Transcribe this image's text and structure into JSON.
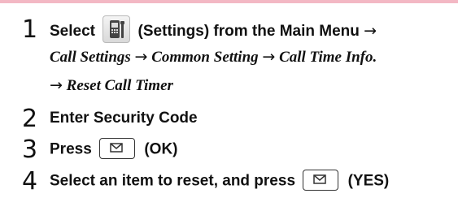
{
  "steps": [
    {
      "number": "1",
      "text_before": "Select",
      "text_after": "(Settings) from the Main Menu",
      "arrow1": "→",
      "path": [
        "Call Settings",
        "Common Setting",
        "Call Time Info.",
        "Reset Call Timer"
      ],
      "arrow": "→"
    },
    {
      "number": "2",
      "text": "Enter Security Code"
    },
    {
      "number": "3",
      "text_before": "Press",
      "text_after": "(OK)"
    },
    {
      "number": "4",
      "text_before": "Select an item to reset, and press",
      "text_after": "(YES)"
    }
  ],
  "icons": {
    "settings": "settings-phone-icon",
    "mail_key": "mail-key-icon"
  }
}
